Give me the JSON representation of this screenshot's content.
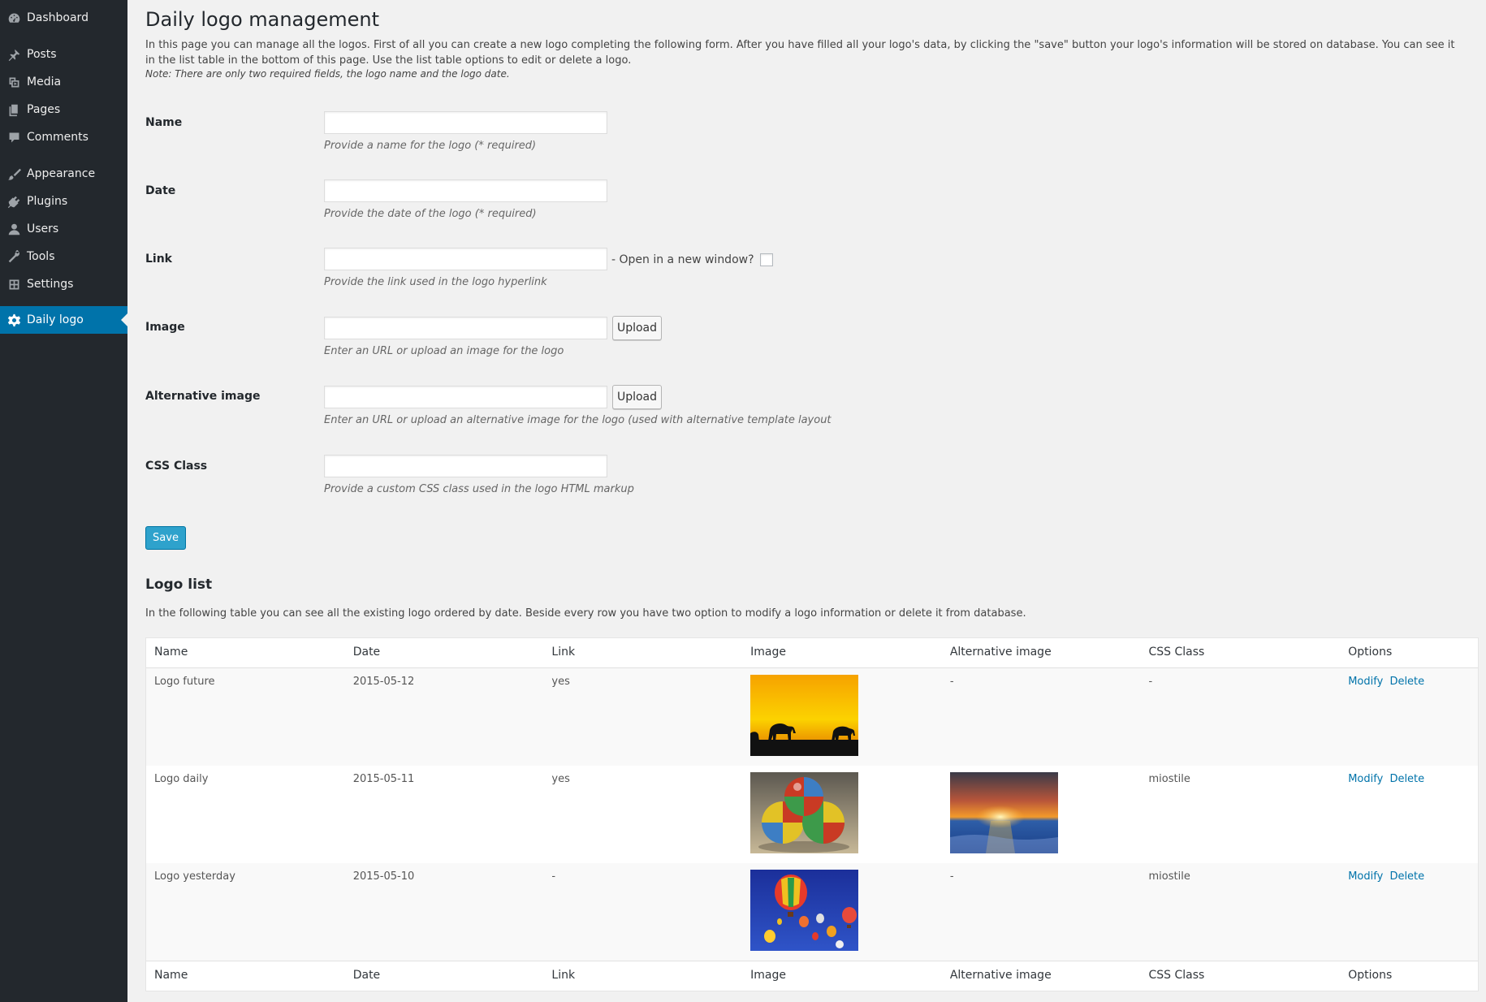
{
  "sidebar": {
    "items": [
      {
        "label": "Dashboard",
        "icon": "dashboard-icon"
      },
      {
        "label": "Posts",
        "icon": "pin-icon"
      },
      {
        "label": "Media",
        "icon": "media-icon"
      },
      {
        "label": "Pages",
        "icon": "pages-icon"
      },
      {
        "label": "Comments",
        "icon": "comment-icon"
      },
      {
        "label": "Appearance",
        "icon": "brush-icon"
      },
      {
        "label": "Plugins",
        "icon": "plugin-icon"
      },
      {
        "label": "Users",
        "icon": "user-icon"
      },
      {
        "label": "Tools",
        "icon": "wrench-icon"
      },
      {
        "label": "Settings",
        "icon": "settings-icon"
      },
      {
        "label": "Daily logo",
        "icon": "gear-icon",
        "active": true
      }
    ],
    "colors": {
      "background": "#23282d",
      "active": "#0073aa"
    }
  },
  "page": {
    "title": "Daily logo management",
    "intro": "In this page you can manage all the logos. First of all you can create a new logo completing the following form. After you have filled all your logo's data, by clicking the \"save\" button your logo's information will be stored on database. You can see it in the list table in the bottom of this page. Use the list table options to edit or delete a logo.",
    "note": "Note: There are only two required fields, the logo name and the logo date."
  },
  "form": {
    "name": {
      "label": "Name",
      "value": "",
      "description": "Provide a name for the logo (* required)"
    },
    "date": {
      "label": "Date",
      "value": "",
      "description": "Provide the date of the logo (* required)"
    },
    "link": {
      "label": "Link",
      "value": "",
      "description": "Provide the link used in the logo hyperlink",
      "new_window_label": "- Open in a new window?",
      "new_window_checked": false
    },
    "image": {
      "label": "Image",
      "value": "",
      "description": "Enter an URL or upload an image for the logo",
      "button": "Upload"
    },
    "alt_image": {
      "label": "Alternative image",
      "value": "",
      "description": "Enter an URL or upload an alternative image for the logo (used with alternative template layout",
      "button": "Upload"
    },
    "css_class": {
      "label": "CSS Class",
      "value": "",
      "description": "Provide a custom CSS class used in the logo HTML markup"
    },
    "save_label": "Save"
  },
  "list": {
    "title": "Logo list",
    "intro": "In the following table you can see all the existing logo ordered by date. Beside every row you have two option to modify a logo information or delete it from database.",
    "columns": [
      "Name",
      "Date",
      "Link",
      "Image",
      "Alternative image",
      "CSS Class",
      "Options"
    ],
    "modify_label": "Modify",
    "delete_label": "Delete",
    "rows": [
      {
        "name": "Logo future",
        "date": "2015-05-12",
        "link": "yes",
        "image": "elephants-sunset",
        "alt_image": "-",
        "css_class": "-"
      },
      {
        "name": "Logo daily",
        "date": "2015-05-11",
        "link": "yes",
        "image": "juggling-balls",
        "alt_image": "ocean-sunset",
        "css_class": "miostile"
      },
      {
        "name": "Logo yesterday",
        "date": "2015-05-10",
        "link": "-",
        "image": "hot-air-balloons",
        "alt_image": "-",
        "css_class": "miostile"
      }
    ]
  }
}
